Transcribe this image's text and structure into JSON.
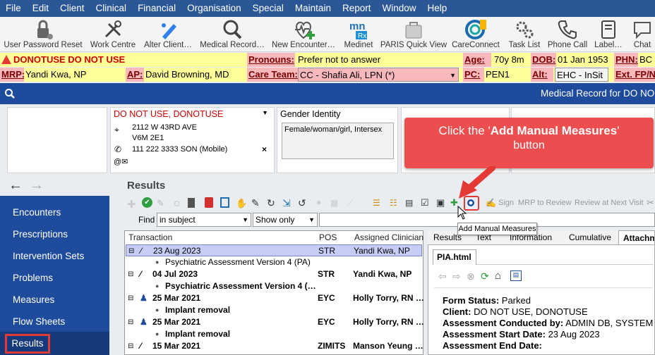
{
  "menu": [
    "File",
    "Edit",
    "Client",
    "Clinical",
    "Financial",
    "Organisation",
    "Special",
    "Maintain",
    "Report",
    "Window",
    "Help"
  ],
  "toolbar": [
    {
      "label": "User Password Reset",
      "icon": "lock-icon"
    },
    {
      "label": "Work Centre",
      "icon": "tools-icon"
    },
    {
      "label": "Alter Client…",
      "icon": "pencil-icon"
    },
    {
      "label": "Medical Record…",
      "icon": "magnifier-icon"
    },
    {
      "label": "New Encounter…",
      "icon": "heartbeat-plus-icon"
    },
    {
      "label": "Medinet",
      "icon": "medinet-icon"
    },
    {
      "label": "PARIS Quick View",
      "icon": "bag-icon"
    },
    {
      "label": "CareConnect",
      "icon": "careconnect-icon"
    },
    {
      "label": "Task List",
      "icon": "gears-icon"
    },
    {
      "label": "Phone Call",
      "icon": "phone-icon"
    },
    {
      "label": "Label…",
      "icon": "binder-icon"
    },
    {
      "label": "Chat",
      "icon": "chat-icon"
    }
  ],
  "banner": {
    "alert": "DONOTUSE DO NOT USE",
    "pronouns_label": "Pronouns:",
    "pronouns": "Prefer not to answer",
    "age_label": "Age:",
    "age": "70y 8m",
    "dob_label": "DOB:",
    "dob": "01 Jan 1953",
    "phn_label": "PHN:",
    "phn": "BC 9",
    "mrp_label": "MRP:",
    "mrp": "Yandi Kwa, NP",
    "ap_label": "AP:",
    "ap": "David Browning, MD",
    "careteam_label": "Care Team:",
    "careteam": "CC - Shafia Ali, LPN (*)",
    "pc_label": "PC:",
    "pc": "PEN1",
    "alt_label": "Alt:",
    "alt": "EHC - InSit",
    "extfp_label": "Ext. FP/N"
  },
  "bluebar_title": "Medical Record for DO NO",
  "client_card": {
    "name": "DO NOT USE, DONOTUSE",
    "address1": "2112 W 43RD AVE",
    "address2": "V6M 2E1",
    "phone": "111 222 3333 SON (Mobile)"
  },
  "gender": {
    "title": "Gender Identity",
    "value": "Female/woman/girl, Intersex"
  },
  "callout": {
    "prefix": "Click the '",
    "bold": "Add Manual Measures",
    "suffix": "'",
    "line2": "button"
  },
  "tooltip": "Add Manual Measures",
  "results_title": "Results",
  "find": {
    "label": "Find",
    "scope": "in subject",
    "show": "Show only"
  },
  "action_links": {
    "sign": "Sign",
    "mrp": "MRP to Review",
    "review": "Review at Next Visit"
  },
  "sidebar": [
    "Encounters",
    "Prescriptions",
    "Intervention Sets",
    "Problems",
    "Measures",
    "Flow Sheets",
    "Results"
  ],
  "table": {
    "headers": [
      "Transaction",
      "POS",
      "Assigned Clinician"
    ],
    "rows": [
      {
        "date": "23 Aug 2023",
        "pos": "STR",
        "clinician": "Yandi Kwa, NP",
        "sub": "Psychiatric Assessment Version 4 (PA)",
        "selected": true,
        "bold": false
      },
      {
        "date": "04 Jul 2023",
        "pos": "STR",
        "clinician": "Yandi Kwa, NP",
        "sub": "Psychiatric Assessment Version 4 (…",
        "selected": false,
        "bold": true
      },
      {
        "date": "25 Mar 2021",
        "pos": "EYC",
        "clinician": "Holly Torry, RN …",
        "sub": "Implant removal",
        "selected": false,
        "bold": true
      },
      {
        "date": "25 Mar 2021",
        "pos": "EYC",
        "clinician": "Holly Torry, RN …",
        "sub": "Implant removal",
        "selected": false,
        "bold": true
      },
      {
        "date": "15 Mar 2021",
        "pos": "ZIMITS",
        "clinician": "Manson Yeung …",
        "sub": "",
        "selected": false,
        "bold": true
      }
    ]
  },
  "right_tabs": [
    "Results",
    "Text",
    "Information",
    "Cumulative",
    "Attachm"
  ],
  "doc": {
    "tab": "PIA.html",
    "lines": [
      {
        "label": "Form Status:",
        "value": " Parked"
      },
      {
        "label": "Client:",
        "value": " DO NOT USE, DONOTUSE"
      },
      {
        "label": "Assessment Conducted by:",
        "value": " ADMIN DB, SYSTEM"
      },
      {
        "label": "Assessment Start Date:",
        "value": " 23 Aug 2023"
      },
      {
        "label": "Assessment End Date:",
        "value": ""
      }
    ]
  },
  "colors": {
    "menu": "#2b5797",
    "sidebar": "#1e4b9b",
    "callout": "#ec4d4f",
    "highlight": "#e53935"
  }
}
